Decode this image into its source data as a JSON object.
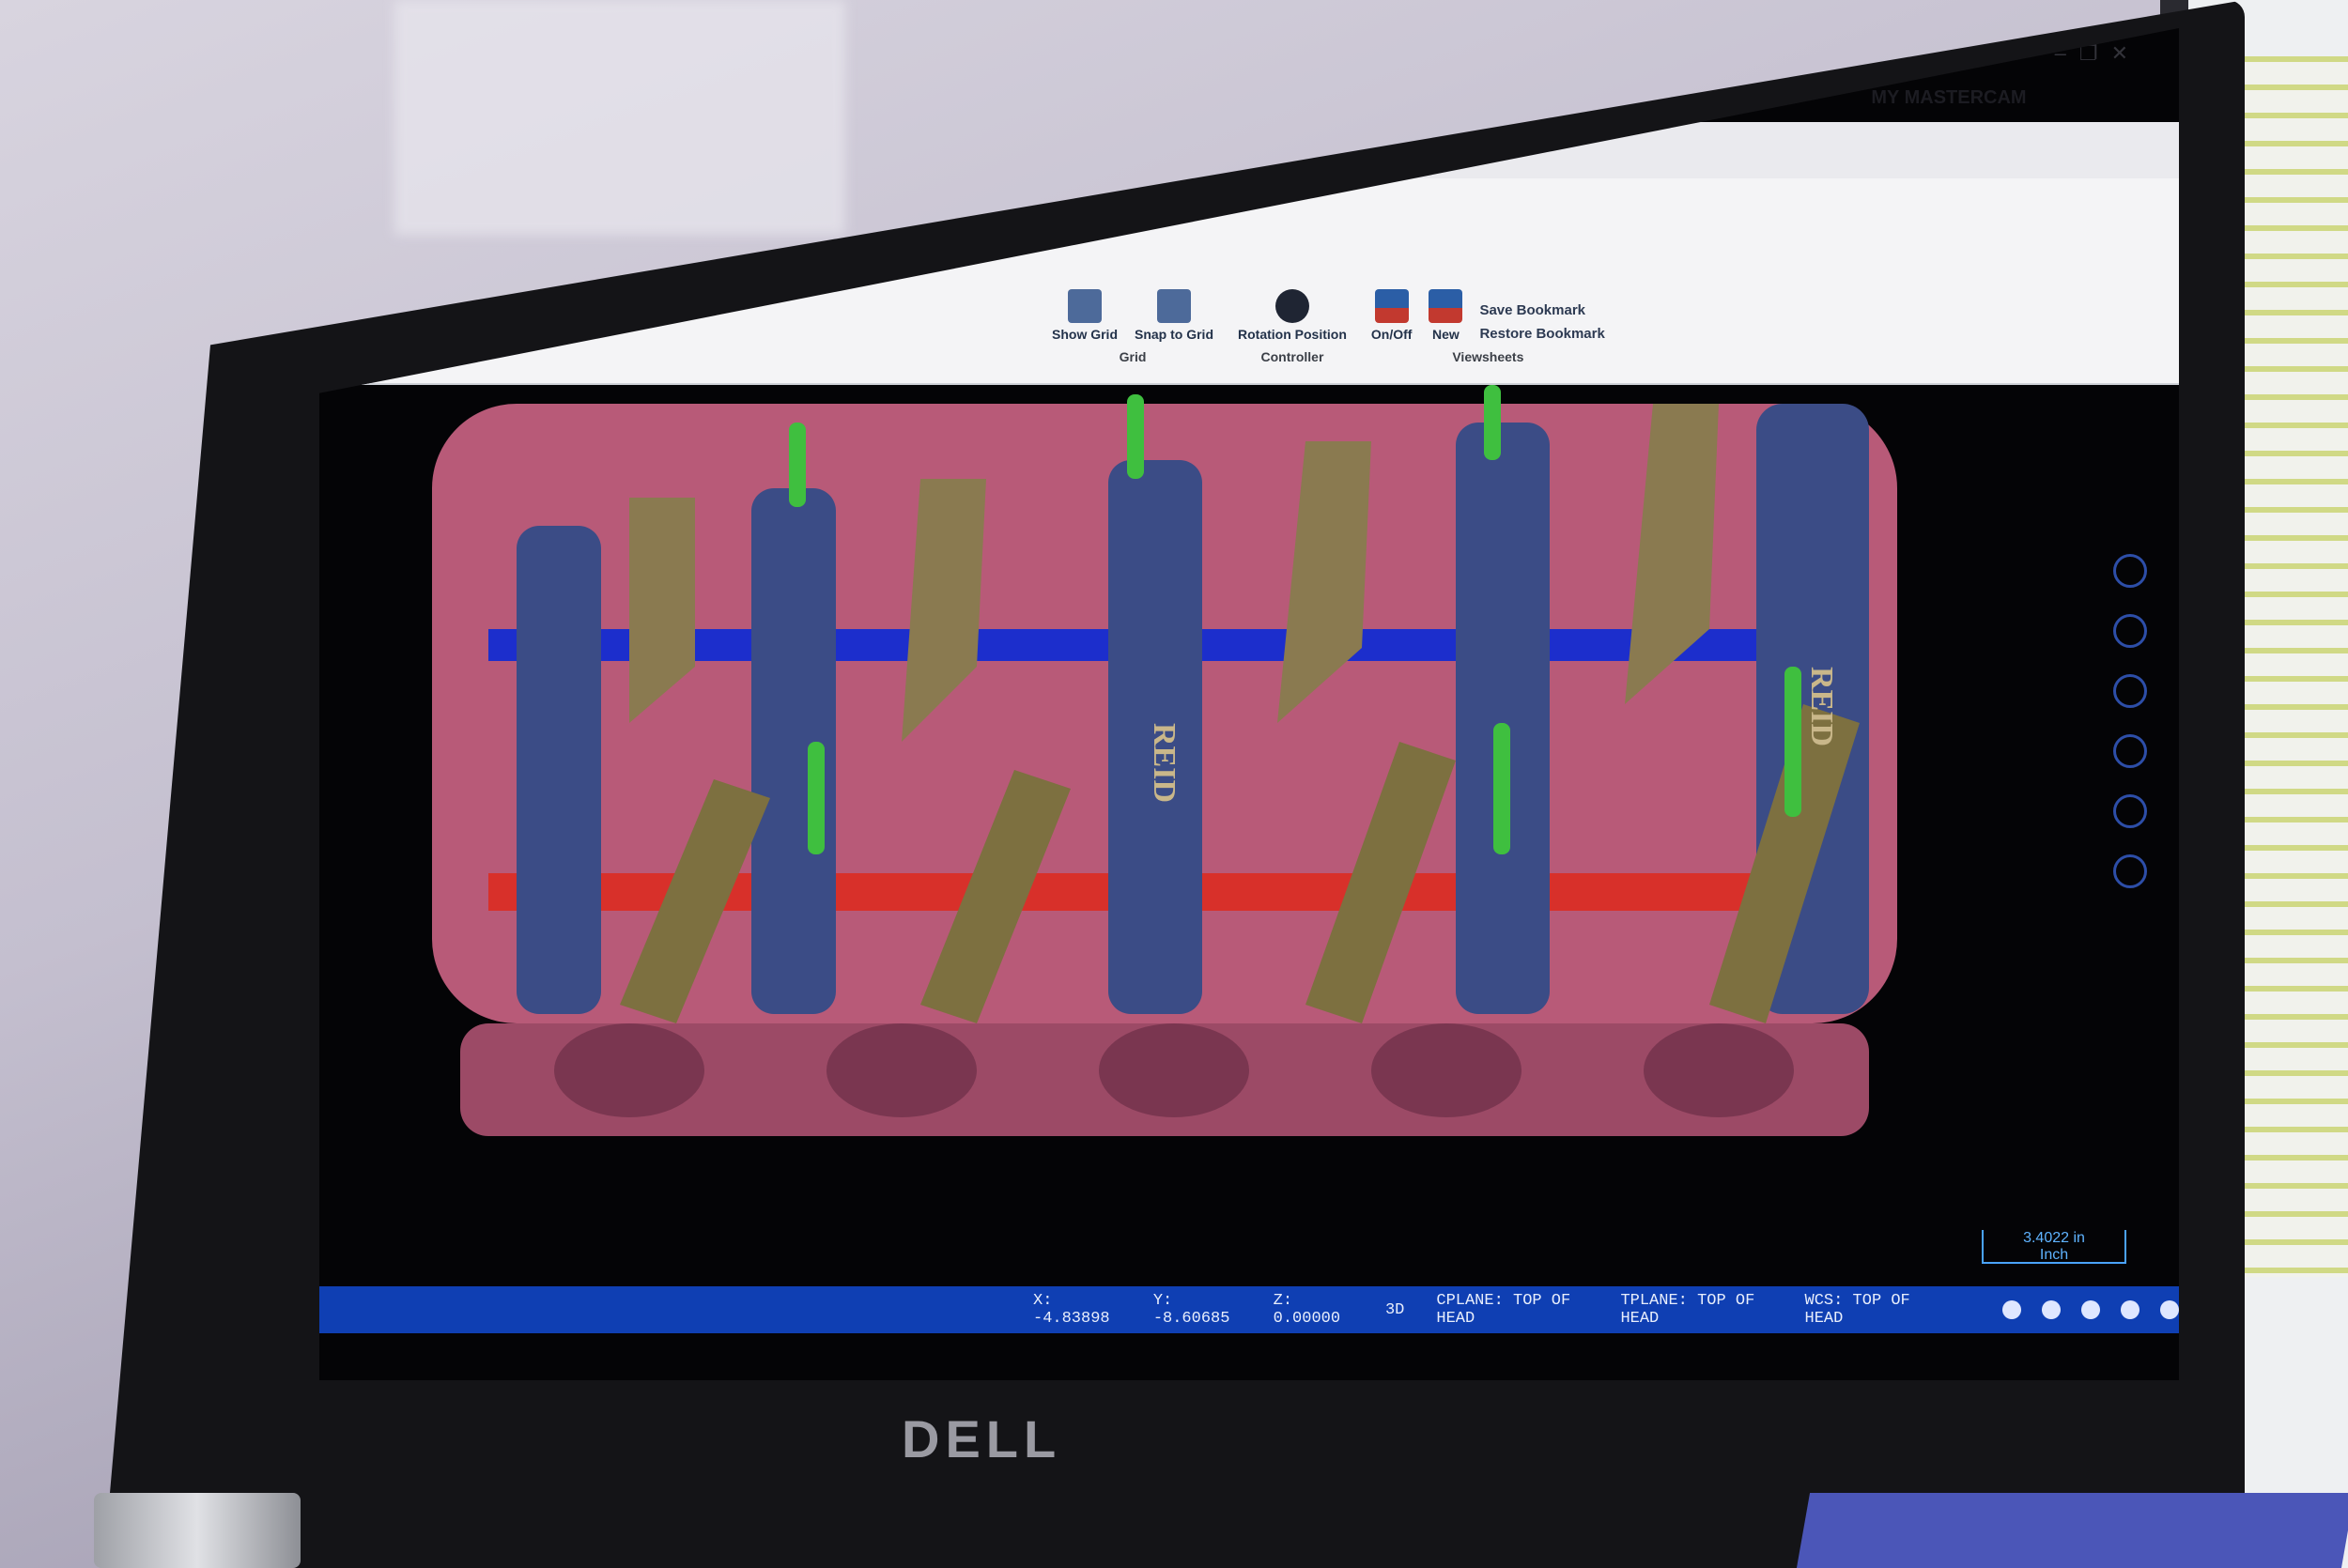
{
  "window": {
    "brand": "MY MASTERCAM",
    "controls": [
      "–",
      "❐",
      "✕"
    ]
  },
  "ribbon": {
    "grid_group": {
      "title": "Grid",
      "buttons": [
        "Show Grid",
        "Snap to Grid"
      ]
    },
    "controller_group": {
      "title": "Controller",
      "buttons": [
        "Rotation Position"
      ]
    },
    "viewsheets_group": {
      "title": "Viewsheets",
      "buttons": [
        "On/Off",
        "New"
      ],
      "bookmarks": [
        "Save Bookmark",
        "Restore Bookmark"
      ]
    }
  },
  "viewport": {
    "part_labels": [
      "REID",
      "REID"
    ]
  },
  "status": {
    "x": "X: -4.83898",
    "y": "Y: -8.60685",
    "z": "Z: 0.00000",
    "mode": "3D",
    "cplane": "CPLANE: TOP OF HEAD",
    "tplane": "TPLANE: TOP OF HEAD",
    "wcs": "WCS: TOP OF HEAD"
  },
  "scale": {
    "value": "3.4022 in",
    "unit": "Inch"
  },
  "monitor_brand": "DELL",
  "colors": {
    "status_bar": "#0f3fb3",
    "part_body": "#b85a78",
    "rocker_arm": "#8a7a50",
    "shaft_blue": "#1c2ecc",
    "shaft_red": "#d8302a",
    "stand": "#3b4c86",
    "pushrod": "#3fbf3f"
  }
}
